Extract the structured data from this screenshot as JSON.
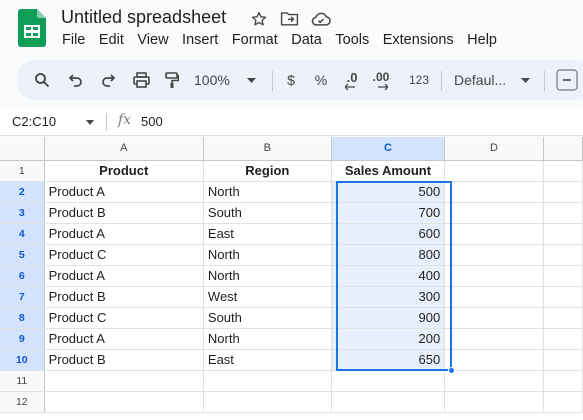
{
  "app": {
    "doc_title": "Untitled spreadsheet",
    "menu": [
      "File",
      "Edit",
      "View",
      "Insert",
      "Format",
      "Data",
      "Tools",
      "Extensions",
      "Help"
    ]
  },
  "toolbar": {
    "zoom": "100%",
    "currency": "$",
    "percent": "%",
    "decrease_decimals": ".0",
    "number_format": "123",
    "font": "Defaul..."
  },
  "formula_bar": {
    "name_box": "C2:C10",
    "fx": "fx",
    "value": "500"
  },
  "grid": {
    "columns": [
      "A",
      "B",
      "C",
      "D"
    ],
    "row_numbers": [
      "1",
      "2",
      "3",
      "4",
      "5",
      "6",
      "7",
      "8",
      "9",
      "10",
      "11",
      "12"
    ],
    "headers": [
      "Product",
      "Region",
      "Sales Amount"
    ],
    "rows": [
      [
        "Product A",
        "North",
        "500"
      ],
      [
        "Product B",
        "South",
        "700"
      ],
      [
        "Product A",
        "East",
        "600"
      ],
      [
        "Product C",
        "North",
        "800"
      ],
      [
        "Product A",
        "North",
        "400"
      ],
      [
        "Product B",
        "West",
        "300"
      ],
      [
        "Product C",
        "South",
        "900"
      ],
      [
        "Product A",
        "North",
        "200"
      ],
      [
        "Product B",
        "East",
        "650"
      ]
    ]
  },
  "colors": {
    "selection": "#1a73e8",
    "selection_fill": "#e8f0fe",
    "header_selected": "#d3e3fd",
    "logo_green": "#0f9d58"
  }
}
